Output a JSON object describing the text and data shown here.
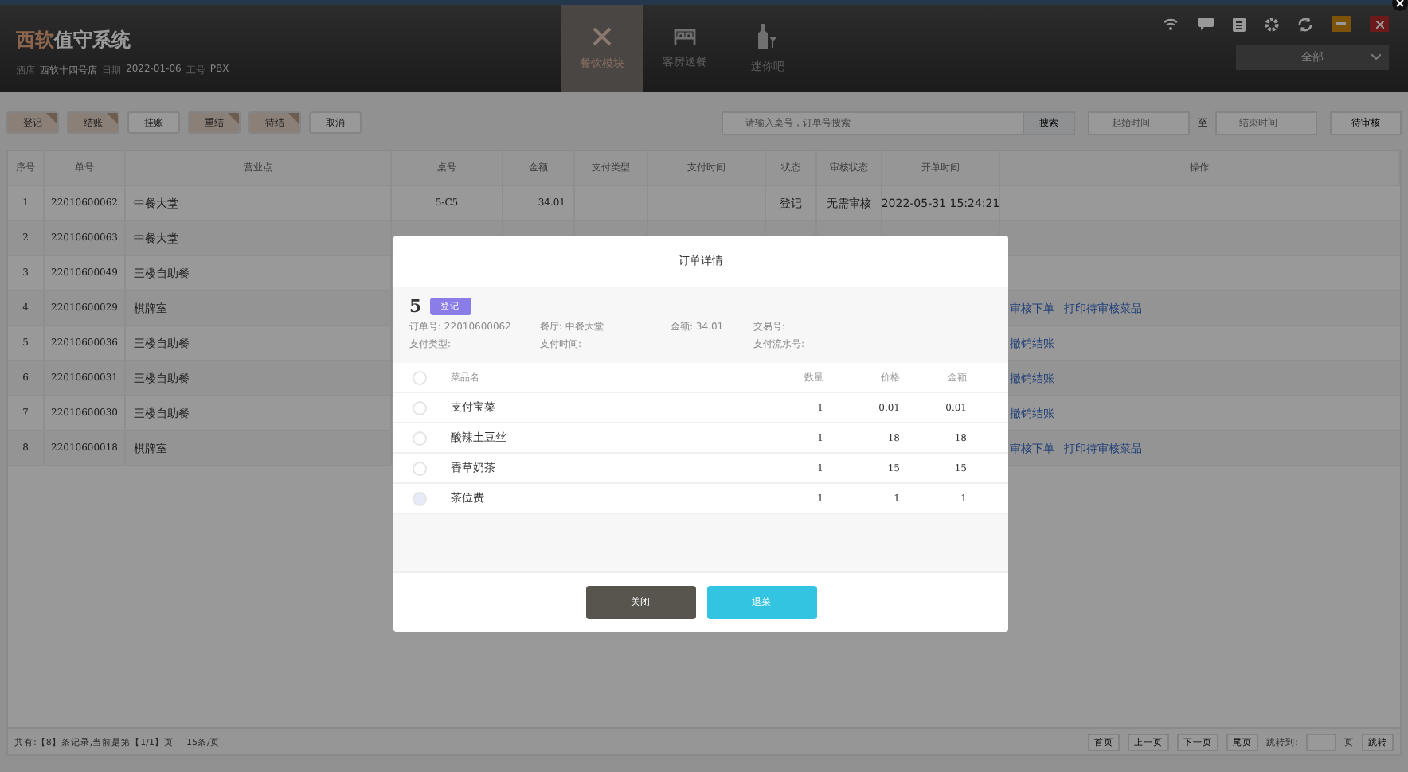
{
  "header": {
    "title_accent": "西软",
    "title_rest": "值守系统",
    "info": [
      {
        "label": "酒店",
        "value": "西软十四号店"
      },
      {
        "label": "日期",
        "value": "2022-01-06"
      },
      {
        "label": "工号",
        "value": "PBX"
      }
    ],
    "nav": [
      {
        "label": "餐饮模块",
        "kind": "dining",
        "selected": true
      },
      {
        "label": "客房送餐",
        "kind": "bed",
        "selected": false
      },
      {
        "label": "迷你吧",
        "kind": "bar",
        "selected": false
      }
    ],
    "filter": "全部"
  },
  "toolbar": {
    "buttons": [
      {
        "label": "登记",
        "selected": true
      },
      {
        "label": "结账",
        "selected": true
      },
      {
        "label": "挂账",
        "selected": false
      },
      {
        "label": "重结",
        "selected": true
      },
      {
        "label": "待结",
        "selected": true
      },
      {
        "label": "取消",
        "selected": false
      }
    ],
    "search": {
      "placeholder": "请输入桌号，订单号搜索",
      "button": "搜索"
    },
    "start": {
      "placeholder": "起始时间"
    },
    "to": "至",
    "end": {
      "placeholder": "结束时间"
    },
    "review_button": "待审核"
  },
  "table": {
    "columns": [
      "序号",
      "单号",
      "营业点",
      "桌号",
      "金额",
      "支付类型",
      "支付时间",
      "状态",
      "审核状态",
      "开单时间",
      "操作"
    ],
    "rows": [
      {
        "cells": [
          "1",
          "22010600062",
          "中餐大堂",
          "5-C5",
          "34.01",
          "",
          "",
          "登记",
          "无需审核",
          "2022-05-31 15:24:21"
        ],
        "actions": []
      },
      {
        "cells": [
          "2",
          "22010600063",
          "中餐大堂"
        ],
        "actions": []
      },
      {
        "cells": [
          "3",
          "22010600049",
          "三楼自助餐"
        ],
        "actions": []
      },
      {
        "cells": [
          "4",
          "22010600029",
          "棋牌室"
        ],
        "actions": [
          "审核下单",
          "打印待审核菜品"
        ]
      },
      {
        "cells": [
          "5",
          "22010600036",
          "三楼自助餐"
        ],
        "actions": [
          "撤销结账"
        ]
      },
      {
        "cells": [
          "6",
          "22010600031",
          "三楼自助餐"
        ],
        "actions": [
          "撤销结账"
        ]
      },
      {
        "cells": [
          "7",
          "22010600030",
          "三楼自助餐"
        ],
        "actions": [
          "撤销结账"
        ]
      },
      {
        "cells": [
          "8",
          "22010600018",
          "棋牌室"
        ],
        "actions": [
          "审核下单",
          "打印待审核菜品"
        ]
      }
    ]
  },
  "footer": {
    "summary": "共有:【8】条记录,当前是第【1/1】页",
    "per_page": "15条/页",
    "buttons": [
      "首页",
      "上一页",
      "下一页",
      "尾页"
    ],
    "jump_label": "跳转到:",
    "page_unit": "页",
    "jump_button": "跳转"
  },
  "dialog": {
    "title": "订单详情",
    "table_no": "5",
    "status": "登记",
    "info": [
      [
        "订单号: 22010600062",
        "支付类型:"
      ],
      [
        "餐厅: 中餐大堂",
        "支付时间:"
      ],
      [
        "金额: 34.01"
      ],
      [
        "交易号:",
        "支付流水号:"
      ]
    ],
    "columns": [
      "菜品名",
      "数量",
      "价格",
      "金额"
    ],
    "select_all_checked": false,
    "items": [
      {
        "name": "支付宝菜",
        "qty": "1",
        "price": "0.01",
        "amount": "0.01",
        "checked": false,
        "disabled": false
      },
      {
        "name": "酸辣土豆丝",
        "qty": "1",
        "price": "18",
        "amount": "18",
        "checked": false,
        "disabled": false
      },
      {
        "name": "香草奶茶",
        "qty": "1",
        "price": "15",
        "amount": "15",
        "checked": false,
        "disabled": false
      },
      {
        "name": "茶位费",
        "qty": "1",
        "price": "1",
        "amount": "1",
        "checked": false,
        "disabled": true
      }
    ],
    "buttons": [
      {
        "label": "关闭",
        "kind": "close"
      },
      {
        "label": "退菜",
        "kind": "return"
      }
    ]
  }
}
